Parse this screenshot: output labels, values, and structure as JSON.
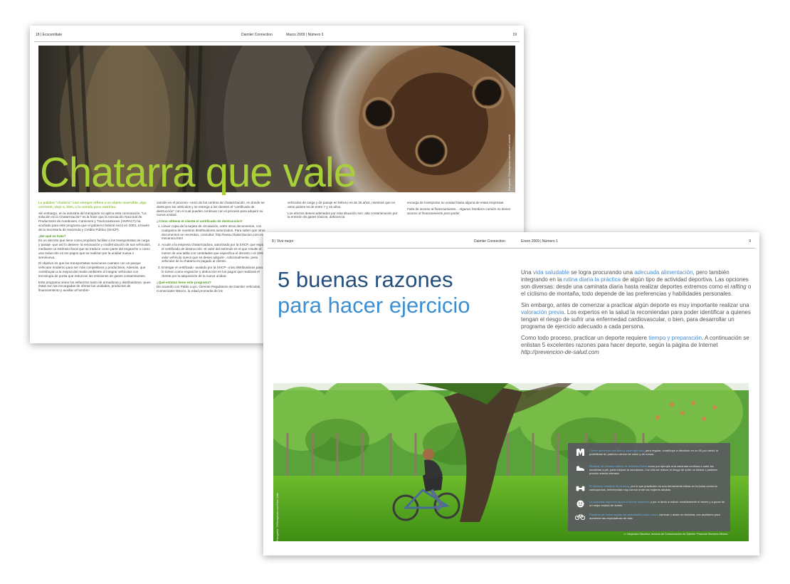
{
  "back_page": {
    "header": {
      "page_section": "18 | Ecocentitate",
      "magazine": "Daimler Connection",
      "issue": "Marzo 2009 | Número 3",
      "page_number": "19"
    },
    "title": "Chatarra que vale",
    "photo_credit": "Fotografía: ©iStockphoto.com/Manuel Lasebelt",
    "col1": {
      "lead": "La palabra \"chatarra\" casi siempre refiere a un objeto inservible, algo corriente, viejo o, bien, a la comida poco nutritiva.",
      "p1": "Sin embargo, en la industria del transporte no aplica esta connotación. \"La solución es la Chatarrización\" es la frase que la Asociación Nacional de Productores de Autobuses, Camiones y Tractocamiones (ANPACT) ha acuñado para este programa que el gobierno federal inició en 2003, a través de la Secretaría de Hacienda y Crédito Público (SHCP).",
      "heading": "¿De qué se trata?",
      "p2": "Es un decreto que tiene como propósito facilitar a los transportistas de carga y pasaje -que así lo deseen- la renovación y modernización de sus vehículos, mediante un estímulo fiscal que se traduce como parte del enganche o como una reducción en los pagos que se realizan por la unidad nueva o seminueva.",
      "p3": "El objetivo es que los transportistas mexicanos cuenten con un parque vehicular moderno para ser más competitivos y productivos. Además, que contribuyan a la mejora del medio ambiente al integrar vehículos con tecnología de punta que reduzcan las emisiones de gases contaminantes.",
      "p4": "Este programa reúne los esfuerzos tanto de armadoras y distribuidoras -pues éstas son las encargadas de ofertar las unidades, productos de financiamiento y auxiliar al hombre-"
    },
    "col2": {
      "p1": "camión en el proceso- como de los centros de chatarrización, en donde se destruyen los vehículos y se entrega a los clientes el \"certificado de destrucción\" con el cual pueden continuar con el proceso para adquirir su nueva unidad.",
      "heading1": "¿Cómo obtiene el cliente el certificado de destrucción?",
      "list": [
        "Llevar copia de la tarjeta de circulación, entre otros documentos, con cualquiera de nuestros distribuidores autorizados. Para saber qué otros documentos se necesitan, consultar: http://www.chatarrizacion.com.mx/ mecanica.html",
        "Acudir a la empresa chatarrizadora, autorizada por la SHCP, que expide el certificado de destrucción -el valor del estímulo es el que resulte el menor de una tabla con cantidades que especifica el decreto o el 15% del valor vehículo nuevo que se desee adquirir-. Adicionalmente, peso vehicular de la chatarra es pagado al cliente.",
        "Entregar el certificado -avalado por la SHCP- a las distribuidoras para que lo tomen como enganche o deducción en los pagos que realizará el cliente por la adquisición de la nueva unidad."
      ],
      "heading2": "¿Qué estatus tiene este programa?",
      "p2": "De acuerdo con Pablo Loyo, Gerente Regulatorio de Daimler Vehículos Comerciales México, la edad promedio de los"
    },
    "col3": {
      "p1": "vehículos de carga y de pasaje en México es de 25 años, mientras que en otros países es de entre 7 y 15 años.",
      "p2": "Los efectos desencadenados por esta situación son: alta contaminación por la emisión de gases tóxicos, deficiencia"
    },
    "col4": {
      "p1": "encarga de transportar su unidad hasta alguna de estas empresas.",
      "p2": "Falta de acceso al financiamiento... Algunos hombres-camión no tienen acceso al financiamiento para poder"
    }
  },
  "front_page": {
    "header": {
      "page_section": "8 | Vivir mejor",
      "magazine": "Daimler Connection",
      "issue": "Enero 2009 | Número 1",
      "page_number": "9"
    },
    "title_line1": "5 buenas razones",
    "title_line2": "para hacer ejercicio",
    "intro": {
      "p1": [
        {
          "t": "Una ",
          "hl": false
        },
        {
          "t": "vida saludable",
          "hl": true
        },
        {
          "t": " se logra procurando una ",
          "hl": false
        },
        {
          "t": "adecuada alimentación",
          "hl": true
        },
        {
          "t": ", pero también integrando en la ",
          "hl": false
        },
        {
          "t": "rutina diaria la práctica",
          "hl": true
        },
        {
          "t": " de algún tipo de actividad deportiva. Las opciones son diversas: desde una caminata diaria hasta realizar deportes extremos como el ",
          "hl": false
        },
        {
          "t": "rafting",
          "hl": false,
          "i": true
        },
        {
          "t": " o el ciclismo de montaña, todo depende de las preferencias y habilidades personales.",
          "hl": false
        }
      ],
      "p2": [
        {
          "t": "Sin embargo, antes de comenzar a practicar algún deporte es muy importante realizar una ",
          "hl": false
        },
        {
          "t": "valoración previa",
          "hl": true
        },
        {
          "t": ". Los expertos en la salud la recomiendan para poder identificar a quienes tengan el riesgo de sufrir una enfermedad cardiovascular, o bien, para desarrollar un programa de ejercicio adecuado a cada persona.",
          "hl": false
        }
      ],
      "p3": [
        {
          "t": "Como todo proceso, practicar un deporte requiere ",
          "hl": false
        },
        {
          "t": "tiempo y preparación",
          "hl": true
        },
        {
          "t": ". A continuación se enlistan 5 excelentes razones para hacer deporte, según la página de Internet ",
          "hl": false
        },
        {
          "t": "http://prevencion-de-salud.com",
          "hl": false,
          "i": true
        }
      ]
    },
    "photo_credit": "Fotografía: ©iStockphoto.com/Nino Zulic",
    "reasons": [
      {
        "icon": "intestine-icon",
        "lead": "Comer alimentos con fibra y hacer ejercicio",
        "rest": ", pero regular, contribuye a disminuir en un 60 por ciento la posibilidad de padecer cáncer de colon y de mama."
      },
      {
        "icon": "shoe-icon",
        "lead": "Realizar 30 minutos diarios de actividad física",
        "rest": " como por ejemplo una caminata continua o subir las escaleras a pie, para mejorar la circulación. Con ello se reduce el riesgo de sufrir un infarto o padecer presión arterial elevada."
      },
      {
        "icon": "bone-icon",
        "lead": "El ejercicio fortalece los huesos",
        "rest": ", por lo que practicarlo es una herramienta eficaz en la lucha contra la osteoporosis, enfermedad muy común entre las mujeres adultas."
      },
      {
        "icon": "smile-icon",
        "lead": "La actividad deportiva ayuda a liberar tensiones",
        "rest": " y por lo tanto a reducir notablemente el estrés y a gozar de un mejor estado de ánimo."
      },
      {
        "icon": "bicycle-icon",
        "lead": "Practicar de forma regular las actividades como correr",
        "rest": ", caminar o andar en bicicleta, con auxiliares para aumentar las expectativas de vida."
      }
    ],
    "source": ">> Alejandro Sánchez, becario de Comunicación de Daimler Financial Services México"
  },
  "colors": {
    "green_title": "#a9cf39",
    "blue_title_dark": "#244f7d",
    "blue_title_light": "#3d8fd1",
    "highlight": "#4a8ed0",
    "infobox": "#5a5a5f"
  }
}
